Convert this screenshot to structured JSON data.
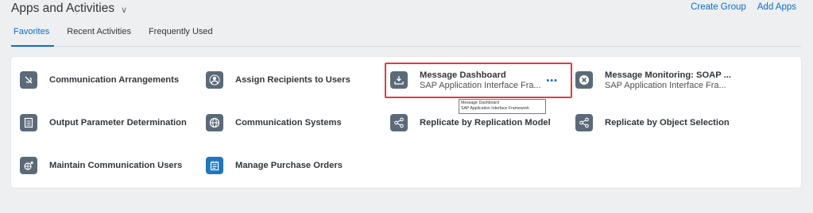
{
  "header": {
    "title": "Apps and Activities",
    "chevron_icon": "chevron-down-icon",
    "actions": {
      "create_group": "Create Group",
      "add_apps": "Add Apps"
    },
    "tabs": [
      {
        "label": "Favorites",
        "active": true
      },
      {
        "label": "Recent Activities",
        "active": false
      },
      {
        "label": "Frequently Used",
        "active": false
      }
    ]
  },
  "tiles": [
    {
      "name": "Communication Arrangements",
      "icon": "connection-icon"
    },
    {
      "name": "Assign Recipients to Users",
      "icon": "recipients-icon"
    },
    {
      "name": "Message Dashboard",
      "sub": "SAP Application Interface Fra...",
      "icon": "download-tray-icon"
    },
    {
      "name": "Message Monitoring: SOAP ...",
      "sub": "SAP Application Interface Fra...",
      "icon": "error-circle-icon"
    },
    {
      "name": "Output Parameter Determination",
      "icon": "checklist-icon"
    },
    {
      "name": "Communication Systems",
      "icon": "globe-icon"
    },
    {
      "name": "Replicate by Replication Model",
      "icon": "share-icon"
    },
    {
      "name": "Replicate by Object Selection",
      "icon": "share-icon"
    },
    {
      "name": "Maintain Communication Users",
      "icon": "user-globe-icon"
    },
    {
      "name": "Manage Purchase Orders",
      "icon": "purchase-order-icon"
    }
  ],
  "tile_more": "•••",
  "tooltip": {
    "line1": "Message Dashboard",
    "line2": "SAP Application Interface Framework"
  },
  "colors": {
    "accent": "#0a6ed1",
    "icon_bg": "#5b6a78",
    "icon_blue": "#1d78c1",
    "highlight": "#e03c3c"
  }
}
